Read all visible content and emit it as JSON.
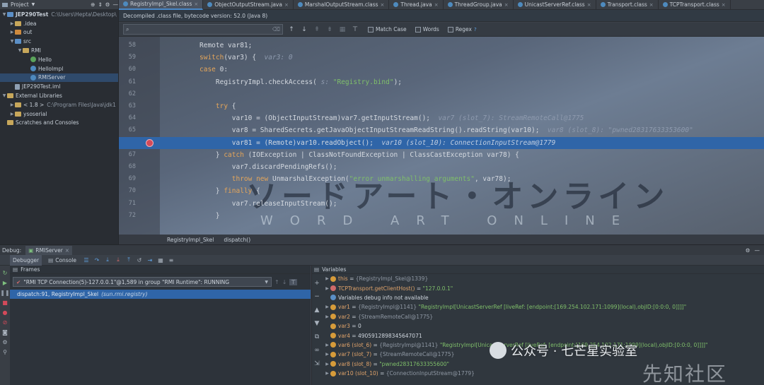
{
  "project_panel": {
    "title": "Project",
    "tree": [
      {
        "indent": 0,
        "twisty": "▼",
        "icon": "folder-blue",
        "label": "JEP290Test",
        "path": "C:\\Users\\Hepta\\Desktop\\"
      },
      {
        "indent": 1,
        "twisty": "▶",
        "icon": "folder",
        "label": ".idea",
        "path": ""
      },
      {
        "indent": 1,
        "twisty": "▶",
        "icon": "folder-orange",
        "label": "out",
        "path": ""
      },
      {
        "indent": 1,
        "twisty": "▼",
        "icon": "folder-blue",
        "label": "src",
        "path": ""
      },
      {
        "indent": 2,
        "twisty": "▼",
        "icon": "folder",
        "label": "RMI",
        "path": ""
      },
      {
        "indent": 3,
        "twisty": "",
        "icon": "interface",
        "label": "Hello",
        "path": ""
      },
      {
        "indent": 3,
        "twisty": "",
        "icon": "class",
        "label": "HelloImpl",
        "path": ""
      },
      {
        "indent": 3,
        "twisty": "",
        "icon": "class",
        "label": "RMIServer",
        "path": "",
        "selected": true
      },
      {
        "indent": 1,
        "twisty": "",
        "icon": "file",
        "label": "JEP290Test.iml",
        "path": ""
      },
      {
        "indent": 0,
        "twisty": "▼",
        "icon": "folder",
        "label": "External Libraries",
        "path": ""
      },
      {
        "indent": 1,
        "twisty": "▶",
        "icon": "folder",
        "label": "< 1.8 >",
        "path": "C:\\Program Files\\Java\\jdk1"
      },
      {
        "indent": 1,
        "twisty": "▶",
        "icon": "folder",
        "label": "ysoserial",
        "path": ""
      },
      {
        "indent": 0,
        "twisty": "",
        "icon": "folder",
        "label": "Scratches and Consoles",
        "path": ""
      }
    ]
  },
  "editor_tabs": [
    {
      "label": "RegistryImpl_Skel.class",
      "active": true
    },
    {
      "label": "ObjectOutputStream.java",
      "active": false
    },
    {
      "label": "MarshalOutputStream.class",
      "active": false
    },
    {
      "label": "Thread.java",
      "active": false
    },
    {
      "label": "ThreadGroup.java",
      "active": false
    },
    {
      "label": "UnicastServerRef.class",
      "active": false
    },
    {
      "label": "Transport.class",
      "active": false
    },
    {
      "label": "TCPTransport.class",
      "active": false
    }
  ],
  "decompiled_banner": "Decompiled .class file, bytecode version: 52.0 (Java 8)",
  "find_bar": {
    "query": "",
    "match_case": "Match Case",
    "words": "Words",
    "regex": "Regex",
    "help": "?"
  },
  "code": [
    {
      "ln": "58",
      "parts": [
        {
          "t": "Remote var81;",
          "c": ""
        }
      ]
    },
    {
      "ln": "59",
      "parts": [
        {
          "t": "switch",
          "c": "kw"
        },
        {
          "t": "(var3) {  ",
          "c": ""
        },
        {
          "t": "var3: 0",
          "c": "hint"
        }
      ]
    },
    {
      "ln": "60",
      "parts": [
        {
          "t": "case ",
          "c": "kw"
        },
        {
          "t": "0:",
          "c": ""
        }
      ]
    },
    {
      "ln": "61",
      "parts": [
        {
          "t": "    RegistryImpl.checkAccess( ",
          "c": ""
        },
        {
          "t": "s: ",
          "c": "hint"
        },
        {
          "t": "\"Registry.bind\"",
          "c": "str"
        },
        {
          "t": ");",
          "c": ""
        }
      ]
    },
    {
      "ln": "62",
      "parts": [
        {
          "t": "",
          "c": ""
        }
      ]
    },
    {
      "ln": "63",
      "parts": [
        {
          "t": "    ",
          "c": ""
        },
        {
          "t": "try",
          "c": "kw"
        },
        {
          "t": " {",
          "c": ""
        }
      ]
    },
    {
      "ln": "64",
      "parts": [
        {
          "t": "        var10 = (ObjectInputStream)var7.getInputStream();  ",
          "c": ""
        },
        {
          "t": "var7 (slot_7): StreamRemoteCall@1775",
          "c": "hint"
        }
      ]
    },
    {
      "ln": "65",
      "parts": [
        {
          "t": "        var8 = SharedSecrets.getJavaObjectInputStreamReadString().readString(var10);  ",
          "c": ""
        },
        {
          "t": "var8 (slot_8): \"pwned28317633353600\"",
          "c": "hint"
        }
      ]
    },
    {
      "ln": "66",
      "parts": [
        {
          "t": "        var81 = (Remote)var10.readObject();  ",
          "c": ""
        },
        {
          "t": "var10 (slot_10): ConnectionInputStream@1779",
          "c": "hint"
        }
      ],
      "highlight": true
    },
    {
      "ln": "67",
      "parts": [
        {
          "t": "    } ",
          "c": ""
        },
        {
          "t": "catch",
          "c": "kw"
        },
        {
          "t": " (IOException | ClassNotFoundException | ClassCastException var78) {",
          "c": ""
        }
      ]
    },
    {
      "ln": "68",
      "parts": [
        {
          "t": "        var7.discardPendingRefs();",
          "c": ""
        }
      ]
    },
    {
      "ln": "69",
      "parts": [
        {
          "t": "        ",
          "c": ""
        },
        {
          "t": "throw new ",
          "c": "kw"
        },
        {
          "t": "UnmarshalException(",
          "c": ""
        },
        {
          "t": "\"error unmarshalling arguments\"",
          "c": "str"
        },
        {
          "t": ", var78);",
          "c": ""
        }
      ]
    },
    {
      "ln": "70",
      "parts": [
        {
          "t": "    } ",
          "c": ""
        },
        {
          "t": "finally",
          "c": "kw"
        },
        {
          "t": " {",
          "c": ""
        }
      ]
    },
    {
      "ln": "71",
      "parts": [
        {
          "t": "        var7.releaseInputStream();",
          "c": ""
        }
      ]
    },
    {
      "ln": "72",
      "parts": [
        {
          "t": "    }",
          "c": ""
        }
      ]
    }
  ],
  "breadcrumb": [
    "RegistryImpl_Skel",
    "dispatch()"
  ],
  "debug": {
    "label": "Debug:",
    "config": "RMIServer",
    "tab_debugger": "Debugger",
    "tab_console": "Console"
  },
  "frames": {
    "title": "Frames",
    "thread": "\"RMI TCP Connection(5)-127.0.0.1\"@1,589 in group \"RMI Runtime\": RUNNING",
    "selected_method": "dispatch:91, RegistryImpl_Skel",
    "selected_pkg": "(sun.rmi.registry)"
  },
  "variables": {
    "title": "Variables",
    "rows": [
      {
        "tw": "▶",
        "badge": "o",
        "name": "this",
        "ref": "{RegistryImpl_Skel@1339}",
        "val": ""
      },
      {
        "tw": "▶",
        "badge": "r",
        "name": "TCPTransport.getClientHost()",
        "ref": "",
        "val": "\"127.0.0.1\""
      },
      {
        "tw": "",
        "badge": "i",
        "name": "",
        "ref": "",
        "val": "Variables debug info not available"
      },
      {
        "tw": "▶",
        "badge": "o",
        "name": "var1",
        "ref": "{RegistryImpl@1141}",
        "val": "\"RegistryImpl[UnicastServerRef [liveRef: [endpoint:[169.254.102.171:1099](local),objID:[0:0:0, 0]]]]\""
      },
      {
        "tw": "▶",
        "badge": "o",
        "name": "var2",
        "ref": "{StreamRemoteCall@1775}",
        "val": ""
      },
      {
        "tw": "",
        "badge": "o",
        "name": "var3",
        "ref": "",
        "val": "0"
      },
      {
        "tw": "",
        "badge": "o",
        "name": "var4",
        "ref": "",
        "val": "4905912898345647071"
      },
      {
        "tw": "▶",
        "badge": "o",
        "name": "var6 (slot_6)",
        "ref": "{RegistryImpl@1141}",
        "val": "\"RegistryImpl[UnicastServerRef [liveRef: [endpoint:[169.254.102.171:1099](local),objID:[0:0:0, 0]]]]\""
      },
      {
        "tw": "▶",
        "badge": "o",
        "name": "var7 (slot_7)",
        "ref": "{StreamRemoteCall@1775}",
        "val": ""
      },
      {
        "tw": "▶",
        "badge": "o",
        "name": "var8 (slot_8)",
        "ref": "",
        "val": "\"pwned28317633355600\""
      },
      {
        "tw": "▶",
        "badge": "o",
        "name": "var10 (slot_10)",
        "ref": "{ConnectionInputStream@1779}",
        "val": ""
      }
    ]
  },
  "watermarks": {
    "editor_jp": "ソードアート・オンライン",
    "editor_en": "WORD ART ONLINE",
    "wechat": "公众号 · 七芒星实验室",
    "corner": "先知社区"
  },
  "colors": {
    "accent": "#2f65a8",
    "keyword": "#e5a65a",
    "string": "#7fbf6a",
    "breakpoint": "#d34a5a"
  }
}
